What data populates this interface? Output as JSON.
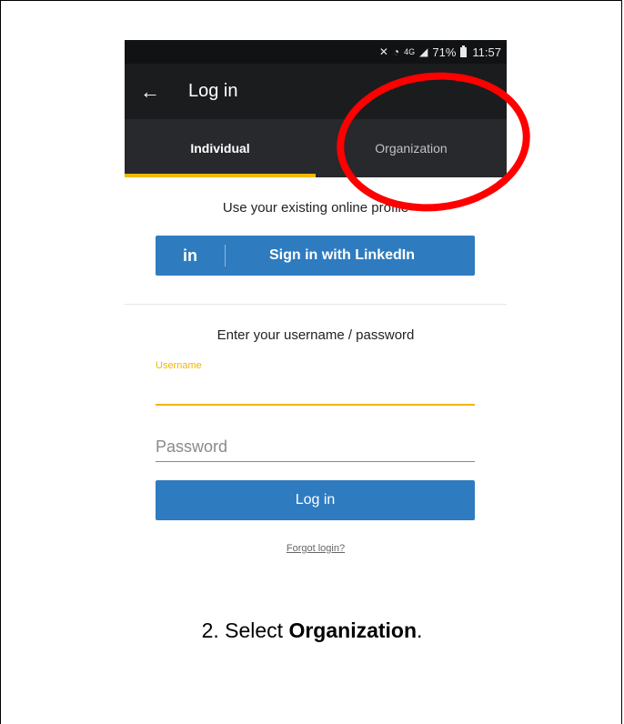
{
  "status_bar": {
    "battery": "71%",
    "time": "11:57",
    "icons": [
      "mute-icon",
      "wifi-icon",
      "4g-icon",
      "signal-icon",
      "battery-icon"
    ]
  },
  "appbar": {
    "title": "Log in",
    "back_icon": "arrow-left-icon"
  },
  "tabs": [
    {
      "label": "Individual",
      "active": true
    },
    {
      "label": "Organization",
      "active": false
    }
  ],
  "intro_text": "Use your existing online profile",
  "linkedin": {
    "logo": "in",
    "label": "Sign in with LinkedIn"
  },
  "form": {
    "heading": "Enter your username / password",
    "username_label": "Username",
    "username_value": "",
    "password_placeholder": "Password",
    "login_label": "Log in",
    "forgot_label": "Forgot login?"
  },
  "caption": {
    "prefix": "2. Select ",
    "bold": "Organization",
    "suffix": "."
  },
  "colors": {
    "accent_yellow": "#f5b800",
    "button_blue": "#2f7bbf",
    "highlight_red": "#ff0000",
    "appbar_bg": "#1b1c1e",
    "tabs_bg": "#27292c"
  }
}
